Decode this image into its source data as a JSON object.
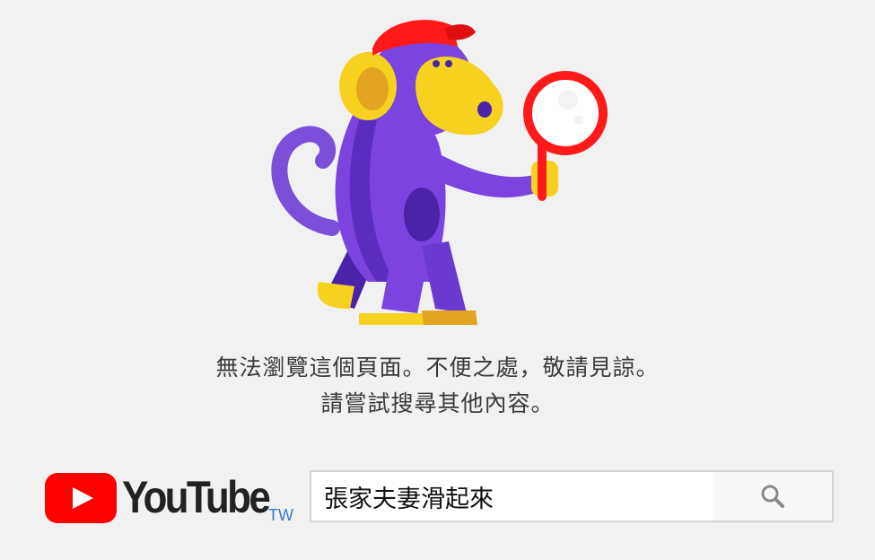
{
  "error": {
    "line1": "無法瀏覽這個頁面。不便之處，敬請見諒。",
    "line2": "請嘗試搜尋其他內容。"
  },
  "logo": {
    "wordmark": "YouTube",
    "region": "TW",
    "brand_color": "#ff0000"
  },
  "search": {
    "value": "張家夫妻滑起來",
    "button_icon": "search-icon"
  },
  "illustration": {
    "name": "monkey-with-magnifying-glass-icon"
  }
}
